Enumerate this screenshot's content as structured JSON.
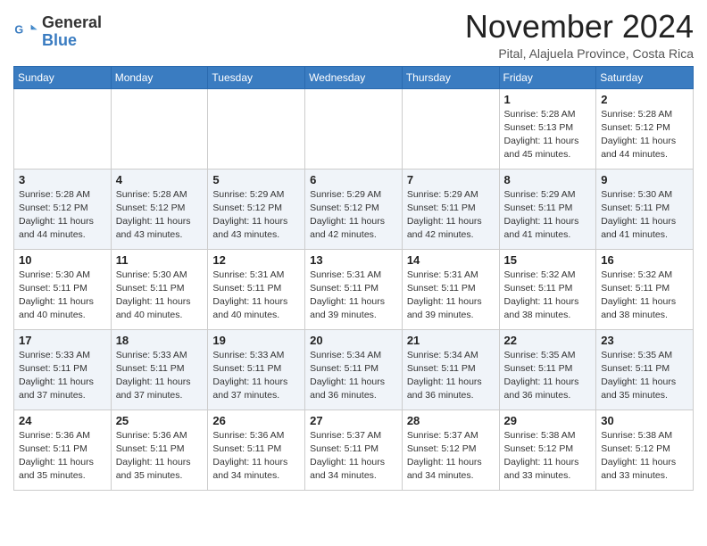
{
  "header": {
    "logo_line1": "General",
    "logo_line2": "Blue",
    "month_title": "November 2024",
    "subtitle": "Pital, Alajuela Province, Costa Rica"
  },
  "weekdays": [
    "Sunday",
    "Monday",
    "Tuesday",
    "Wednesday",
    "Thursday",
    "Friday",
    "Saturday"
  ],
  "weeks": [
    [
      {
        "day": "",
        "info": ""
      },
      {
        "day": "",
        "info": ""
      },
      {
        "day": "",
        "info": ""
      },
      {
        "day": "",
        "info": ""
      },
      {
        "day": "",
        "info": ""
      },
      {
        "day": "1",
        "info": "Sunrise: 5:28 AM\nSunset: 5:13 PM\nDaylight: 11 hours\nand 45 minutes."
      },
      {
        "day": "2",
        "info": "Sunrise: 5:28 AM\nSunset: 5:12 PM\nDaylight: 11 hours\nand 44 minutes."
      }
    ],
    [
      {
        "day": "3",
        "info": "Sunrise: 5:28 AM\nSunset: 5:12 PM\nDaylight: 11 hours\nand 44 minutes."
      },
      {
        "day": "4",
        "info": "Sunrise: 5:28 AM\nSunset: 5:12 PM\nDaylight: 11 hours\nand 43 minutes."
      },
      {
        "day": "5",
        "info": "Sunrise: 5:29 AM\nSunset: 5:12 PM\nDaylight: 11 hours\nand 43 minutes."
      },
      {
        "day": "6",
        "info": "Sunrise: 5:29 AM\nSunset: 5:12 PM\nDaylight: 11 hours\nand 42 minutes."
      },
      {
        "day": "7",
        "info": "Sunrise: 5:29 AM\nSunset: 5:11 PM\nDaylight: 11 hours\nand 42 minutes."
      },
      {
        "day": "8",
        "info": "Sunrise: 5:29 AM\nSunset: 5:11 PM\nDaylight: 11 hours\nand 41 minutes."
      },
      {
        "day": "9",
        "info": "Sunrise: 5:30 AM\nSunset: 5:11 PM\nDaylight: 11 hours\nand 41 minutes."
      }
    ],
    [
      {
        "day": "10",
        "info": "Sunrise: 5:30 AM\nSunset: 5:11 PM\nDaylight: 11 hours\nand 40 minutes."
      },
      {
        "day": "11",
        "info": "Sunrise: 5:30 AM\nSunset: 5:11 PM\nDaylight: 11 hours\nand 40 minutes."
      },
      {
        "day": "12",
        "info": "Sunrise: 5:31 AM\nSunset: 5:11 PM\nDaylight: 11 hours\nand 40 minutes."
      },
      {
        "day": "13",
        "info": "Sunrise: 5:31 AM\nSunset: 5:11 PM\nDaylight: 11 hours\nand 39 minutes."
      },
      {
        "day": "14",
        "info": "Sunrise: 5:31 AM\nSunset: 5:11 PM\nDaylight: 11 hours\nand 39 minutes."
      },
      {
        "day": "15",
        "info": "Sunrise: 5:32 AM\nSunset: 5:11 PM\nDaylight: 11 hours\nand 38 minutes."
      },
      {
        "day": "16",
        "info": "Sunrise: 5:32 AM\nSunset: 5:11 PM\nDaylight: 11 hours\nand 38 minutes."
      }
    ],
    [
      {
        "day": "17",
        "info": "Sunrise: 5:33 AM\nSunset: 5:11 PM\nDaylight: 11 hours\nand 37 minutes."
      },
      {
        "day": "18",
        "info": "Sunrise: 5:33 AM\nSunset: 5:11 PM\nDaylight: 11 hours\nand 37 minutes."
      },
      {
        "day": "19",
        "info": "Sunrise: 5:33 AM\nSunset: 5:11 PM\nDaylight: 11 hours\nand 37 minutes."
      },
      {
        "day": "20",
        "info": "Sunrise: 5:34 AM\nSunset: 5:11 PM\nDaylight: 11 hours\nand 36 minutes."
      },
      {
        "day": "21",
        "info": "Sunrise: 5:34 AM\nSunset: 5:11 PM\nDaylight: 11 hours\nand 36 minutes."
      },
      {
        "day": "22",
        "info": "Sunrise: 5:35 AM\nSunset: 5:11 PM\nDaylight: 11 hours\nand 36 minutes."
      },
      {
        "day": "23",
        "info": "Sunrise: 5:35 AM\nSunset: 5:11 PM\nDaylight: 11 hours\nand 35 minutes."
      }
    ],
    [
      {
        "day": "24",
        "info": "Sunrise: 5:36 AM\nSunset: 5:11 PM\nDaylight: 11 hours\nand 35 minutes."
      },
      {
        "day": "25",
        "info": "Sunrise: 5:36 AM\nSunset: 5:11 PM\nDaylight: 11 hours\nand 35 minutes."
      },
      {
        "day": "26",
        "info": "Sunrise: 5:36 AM\nSunset: 5:11 PM\nDaylight: 11 hours\nand 34 minutes."
      },
      {
        "day": "27",
        "info": "Sunrise: 5:37 AM\nSunset: 5:11 PM\nDaylight: 11 hours\nand 34 minutes."
      },
      {
        "day": "28",
        "info": "Sunrise: 5:37 AM\nSunset: 5:12 PM\nDaylight: 11 hours\nand 34 minutes."
      },
      {
        "day": "29",
        "info": "Sunrise: 5:38 AM\nSunset: 5:12 PM\nDaylight: 11 hours\nand 33 minutes."
      },
      {
        "day": "30",
        "info": "Sunrise: 5:38 AM\nSunset: 5:12 PM\nDaylight: 11 hours\nand 33 minutes."
      }
    ]
  ]
}
